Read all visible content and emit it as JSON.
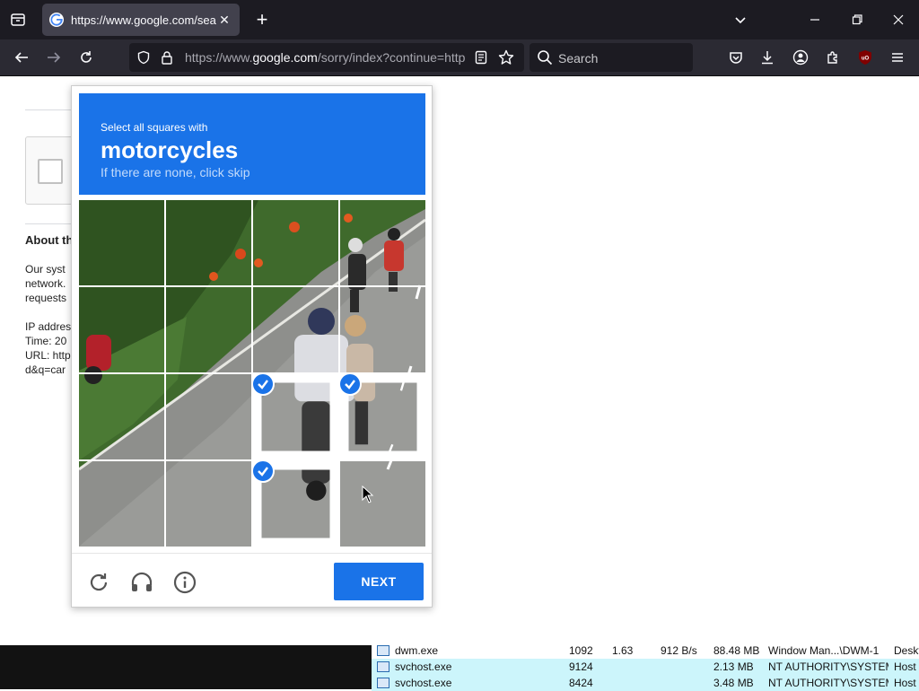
{
  "browser": {
    "tab_title": "https://www.google.com/search",
    "url_prefix": "https://www.",
    "url_domain": "google.com",
    "url_rest": "/sorry/index?continue=https",
    "search_placeholder": "Search"
  },
  "page_bg": {
    "about_heading": "About th",
    "line1": "Our syst",
    "line2": "network.",
    "line3": "requests",
    "line4": "IP addres",
    "line5": "Time: 20",
    "line6": "URL: http",
    "line7": "d&q=car"
  },
  "captcha": {
    "instruction": "Select all squares with",
    "target": "motorcycles",
    "subtext": "If there are none, click skip",
    "next_label": "NEXT",
    "selected_tiles": [
      10,
      11,
      14
    ],
    "colors": {
      "accent": "#1a73e8"
    }
  },
  "processes": [
    {
      "name": "dwm.exe",
      "pid": "1092",
      "cpu": "1.63",
      "io": "912 B/s",
      "mem": "88.48 MB",
      "user": "Window Man...\\DWM-1",
      "desc": "Deskt"
    },
    {
      "name": "svchost.exe",
      "pid": "9124",
      "cpu": "",
      "io": "",
      "mem": "2.13 MB",
      "user": "NT AUTHORITY\\SYSTEM",
      "desc": "Host"
    },
    {
      "name": "svchost.exe",
      "pid": "8424",
      "cpu": "",
      "io": "",
      "mem": "3.48 MB",
      "user": "NT AUTHORITY\\SYSTEM",
      "desc": "Host"
    }
  ]
}
